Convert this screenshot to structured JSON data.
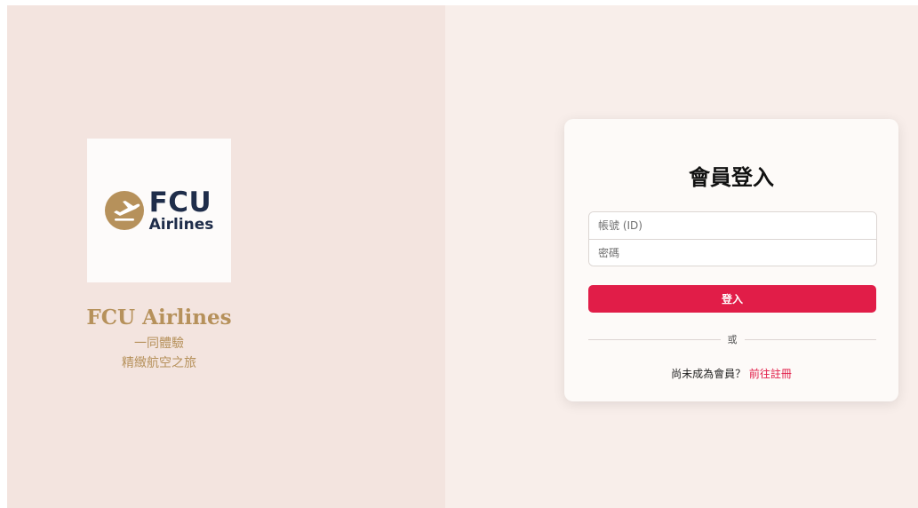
{
  "brand": {
    "logo_main": "FCU",
    "logo_sub": "Airlines",
    "name": "FCU Airlines",
    "tagline_1": "一同體驗",
    "tagline_2": "精緻航空之旅",
    "colors": {
      "gold": "#b6915b",
      "navy": "#1f2d4a"
    }
  },
  "login": {
    "title": "會員登入",
    "id_placeholder": "帳號 (ID)",
    "password_placeholder": "密碼",
    "submit_label": "登入",
    "divider_text": "或",
    "register_prompt": "尚未成為會員？",
    "register_link": "前往註冊",
    "accent_color": "#e11d48"
  }
}
